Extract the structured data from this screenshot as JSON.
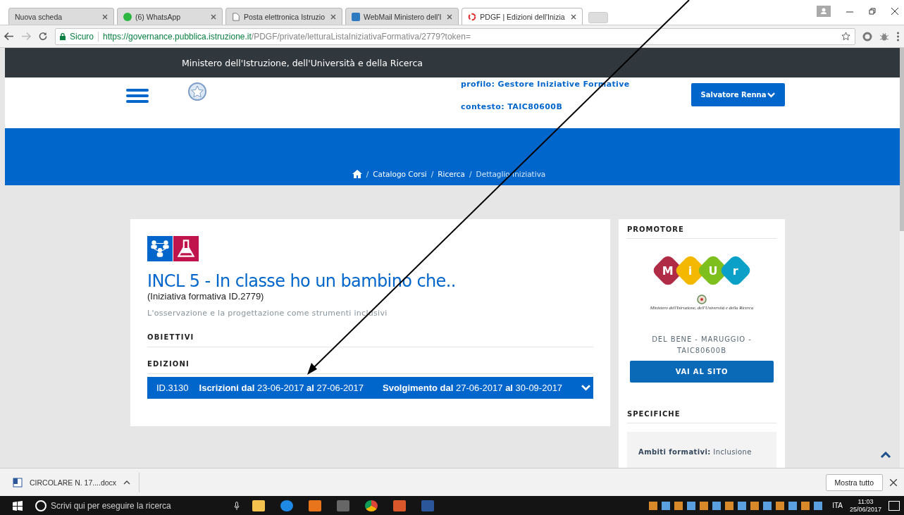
{
  "browser": {
    "tabs": [
      {
        "label": "Nuova scheda",
        "kind": "blank",
        "selected": false
      },
      {
        "label": "(6) WhatsApp",
        "kind": "chat",
        "selected": false
      },
      {
        "label": "Posta elettronica Istruzio",
        "kind": "doc",
        "selected": false
      },
      {
        "label": "WebMail Ministero dell'I",
        "kind": "mail",
        "selected": false
      },
      {
        "label": "PDGF | Edizioni dell'Inizia",
        "kind": "ring",
        "selected": true
      }
    ],
    "secure_label": "Sicuro",
    "url_host": "https://governance.pubblica.istruzione.it",
    "url_path": "/PDGF/private/letturaListaIniziativaFormativa/2779?token="
  },
  "site_header": {
    "ministry": "Ministero dell'Istruzione, dell'Università e della Ricerca",
    "profile": "profilo: Gestore Iniziative Formative",
    "context": "contesto: TAIC80600B",
    "user": "Salvatore Renna"
  },
  "breadcrumb": [
    {
      "separator": "/",
      "label": "Catalogo Corsi"
    },
    {
      "separator": "/",
      "label": "Ricerca"
    },
    {
      "separator": "/",
      "label": "Dettaglio Iniziativa"
    }
  ],
  "initiative": {
    "title": "INCL 5 - In classe ho un bambino che..",
    "id_line": "(Iniziativa formativa ID.2779)",
    "subtitle": "L'osservazione e la progettazione come strumenti inclusivi",
    "sections": [
      "OBIETTIVI",
      "EDIZIONI"
    ],
    "editions": [
      {
        "id": "ID.3130",
        "enrolment": "**Iscrizioni dal** 23-06-2017 **al** 27-06-2017",
        "running": "**Svolgimento dal** 27-06-2017 **al** 30-09-2017",
        "expanded": false
      }
    ]
  },
  "promoter": {
    "heading": "PROMOTORE",
    "logo_letters": [
      {
        "text": "M",
        "color": "#b02c46"
      },
      {
        "text": "i",
        "color": "#f5b800"
      },
      {
        "text": "U",
        "color": "#7ebf1e"
      },
      {
        "text": "r",
        "color": "#0aa0c8"
      }
    ],
    "logo_caption": "Ministero dell'Istruzione, dell'Università e della Ricerca",
    "name": "DEL BENE - MARUGGIO - TAIC80600B",
    "button": "VAI AL SITO"
  },
  "specs": {
    "heading": "SPECIFICHE",
    "label": "Ambiti formativi:",
    "value": "Inclusione"
  },
  "downloads": {
    "file": "CIRCOLARE N. 17....docx",
    "show_all": "Mostra tutto"
  },
  "taskbar": {
    "search_placeholder": "Scrivi qui per eseguire la ricerca",
    "language": "ITA",
    "time": "11:03",
    "date": "25/06/2017"
  }
}
